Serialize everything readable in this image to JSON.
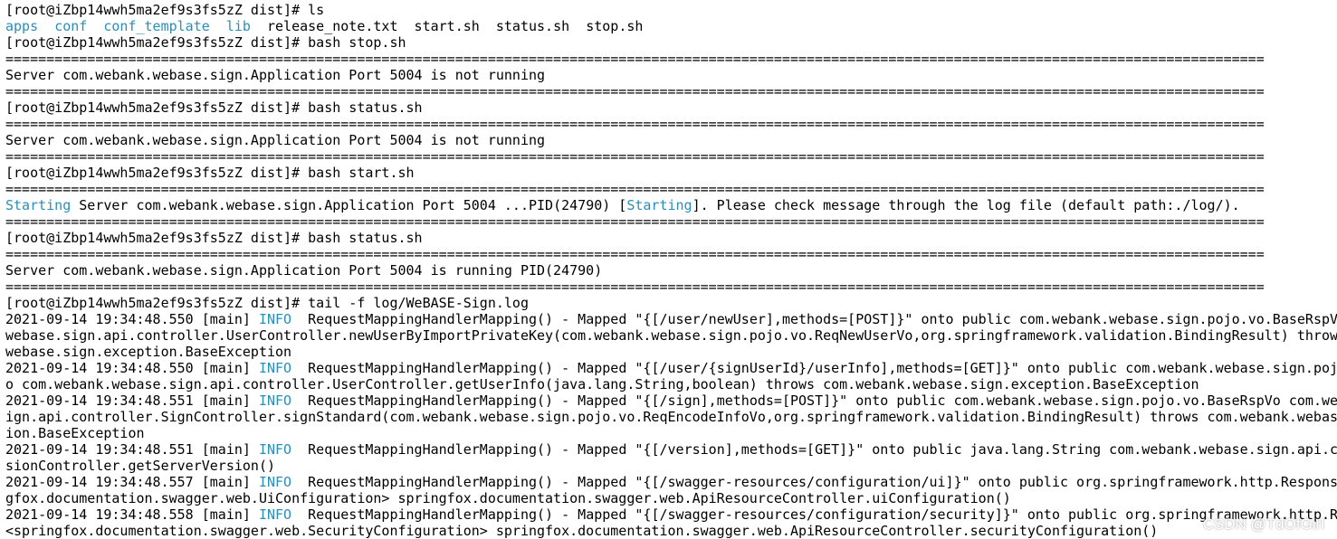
{
  "terminal": {
    "lines": [
      [
        {
          "t": "[root@iZbp14wwh5ma2ef9s3fs5zZ dist]# ls"
        }
      ],
      [
        {
          "t": "apps",
          "c": "cyan"
        },
        {
          "t": "  "
        },
        {
          "t": "conf",
          "c": "cyan"
        },
        {
          "t": "  "
        },
        {
          "t": "conf_template",
          "c": "cyan"
        },
        {
          "t": "  "
        },
        {
          "t": "lib",
          "c": "cyan"
        },
        {
          "t": "  release_note.txt  start.sh  status.sh  stop.sh"
        }
      ],
      [
        {
          "t": "[root@iZbp14wwh5ma2ef9s3fs5zZ dist]# bash stop.sh"
        }
      ],
      [
        {
          "t": "=========================================================================================================================================================="
        }
      ],
      [
        {
          "t": "Server com.webank.webase.sign.Application Port 5004 is not running"
        }
      ],
      [
        {
          "t": "=========================================================================================================================================================="
        }
      ],
      [
        {
          "t": "[root@iZbp14wwh5ma2ef9s3fs5zZ dist]# bash status.sh"
        }
      ],
      [
        {
          "t": "=========================================================================================================================================================="
        }
      ],
      [
        {
          "t": "Server com.webank.webase.sign.Application Port 5004 is not running"
        }
      ],
      [
        {
          "t": "=========================================================================================================================================================="
        }
      ],
      [
        {
          "t": "[root@iZbp14wwh5ma2ef9s3fs5zZ dist]# bash start.sh"
        }
      ],
      [
        {
          "t": "=========================================================================================================================================================="
        }
      ],
      [
        {
          "t": "Starting",
          "c": "cyan"
        },
        {
          "t": " Server com.webank.webase.sign.Application Port 5004 ...PID(24790) ["
        },
        {
          "t": "Starting",
          "c": "cyan"
        },
        {
          "t": "]. Please check message through the log file (default path:./log/)."
        }
      ],
      [
        {
          "t": "=========================================================================================================================================================="
        }
      ],
      [
        {
          "t": "[root@iZbp14wwh5ma2ef9s3fs5zZ dist]# bash status.sh"
        }
      ],
      [
        {
          "t": "=========================================================================================================================================================="
        }
      ],
      [
        {
          "t": "Server com.webank.webase.sign.Application Port 5004 is running PID(24790)"
        }
      ],
      [
        {
          "t": "=========================================================================================================================================================="
        }
      ],
      [
        {
          "t": "[root@iZbp14wwh5ma2ef9s3fs5zZ dist]# tail -f log/WeBASE-Sign.log"
        }
      ],
      [
        {
          "t": "2021-09-14 19:34:48.550 [main] "
        },
        {
          "t": "INFO",
          "c": "cyan"
        },
        {
          "t": "  RequestMappingHandlerMapping() - Mapped \"{[/user/newUser],methods=[POST]}\" onto public com.webank.webase.sign.pojo.vo.BaseRspVo"
        }
      ],
      [
        {
          "t": "webase.sign.api.controller.UserController.newUserByImportPrivateKey(com.webank.webase.sign.pojo.vo.ReqNewUserVo,org.springframework.validation.BindingResult) throws"
        }
      ],
      [
        {
          "t": "webase.sign.exception.BaseException"
        }
      ],
      [
        {
          "t": "2021-09-14 19:34:48.550 [main] "
        },
        {
          "t": "INFO",
          "c": "cyan"
        },
        {
          "t": "  RequestMappingHandlerMapping() - Mapped \"{[/user/{signUserId}/userInfo],methods=[GET]}\" onto public com.webank.webase.sign.pojo"
        }
      ],
      [
        {
          "t": "o com.webank.webase.sign.api.controller.UserController.getUserInfo(java.lang.String,boolean) throws com.webank.webase.sign.exception.BaseException"
        }
      ],
      [
        {
          "t": "2021-09-14 19:34:48.551 [main] "
        },
        {
          "t": "INFO",
          "c": "cyan"
        },
        {
          "t": "  RequestMappingHandlerMapping() - Mapped \"{[/sign],methods=[POST]}\" onto public com.webank.webase.sign.pojo.vo.BaseRspVo com.web"
        }
      ],
      [
        {
          "t": "ign.api.controller.SignController.signStandard(com.webank.webase.sign.pojo.vo.ReqEncodeInfoVo,org.springframework.validation.BindingResult) throws com.webank.webase"
        }
      ],
      [
        {
          "t": "ion.BaseException"
        }
      ],
      [
        {
          "t": "2021-09-14 19:34:48.551 [main] "
        },
        {
          "t": "INFO",
          "c": "cyan"
        },
        {
          "t": "  RequestMappingHandlerMapping() - Mapped \"{[/version],methods=[GET]}\" onto public java.lang.String com.webank.webase.sign.api.co"
        }
      ],
      [
        {
          "t": "sionController.getServerVersion()"
        }
      ],
      [
        {
          "t": "2021-09-14 19:34:48.557 [main] "
        },
        {
          "t": "INFO",
          "c": "cyan"
        },
        {
          "t": "  RequestMappingHandlerMapping() - Mapped \"{[/swagger-resources/configuration/ui]}\" onto public org.springframework.http.Response"
        }
      ],
      [
        {
          "t": "gfox.documentation.swagger.web.UiConfiguration> springfox.documentation.swagger.web.ApiResourceController.uiConfiguration()"
        }
      ],
      [
        {
          "t": "2021-09-14 19:34:48.558 [main] "
        },
        {
          "t": "INFO",
          "c": "cyan"
        },
        {
          "t": "  RequestMappingHandlerMapping() - Mapped \"{[/swagger-resources/configuration/security]}\" onto public org.springframework.http.Re"
        }
      ],
      [
        {
          "t": "<springfox.documentation.swagger.web.SecurityConfiguration> springfox.documentation.swagger.web.ApiResourceController.securityConfiguration()"
        }
      ]
    ]
  },
  "watermark": "CSDN @TdOfGirl",
  "colors": {
    "background": "#ffffff",
    "text": "#000000",
    "accent_cyan": "#2a8fb8"
  }
}
